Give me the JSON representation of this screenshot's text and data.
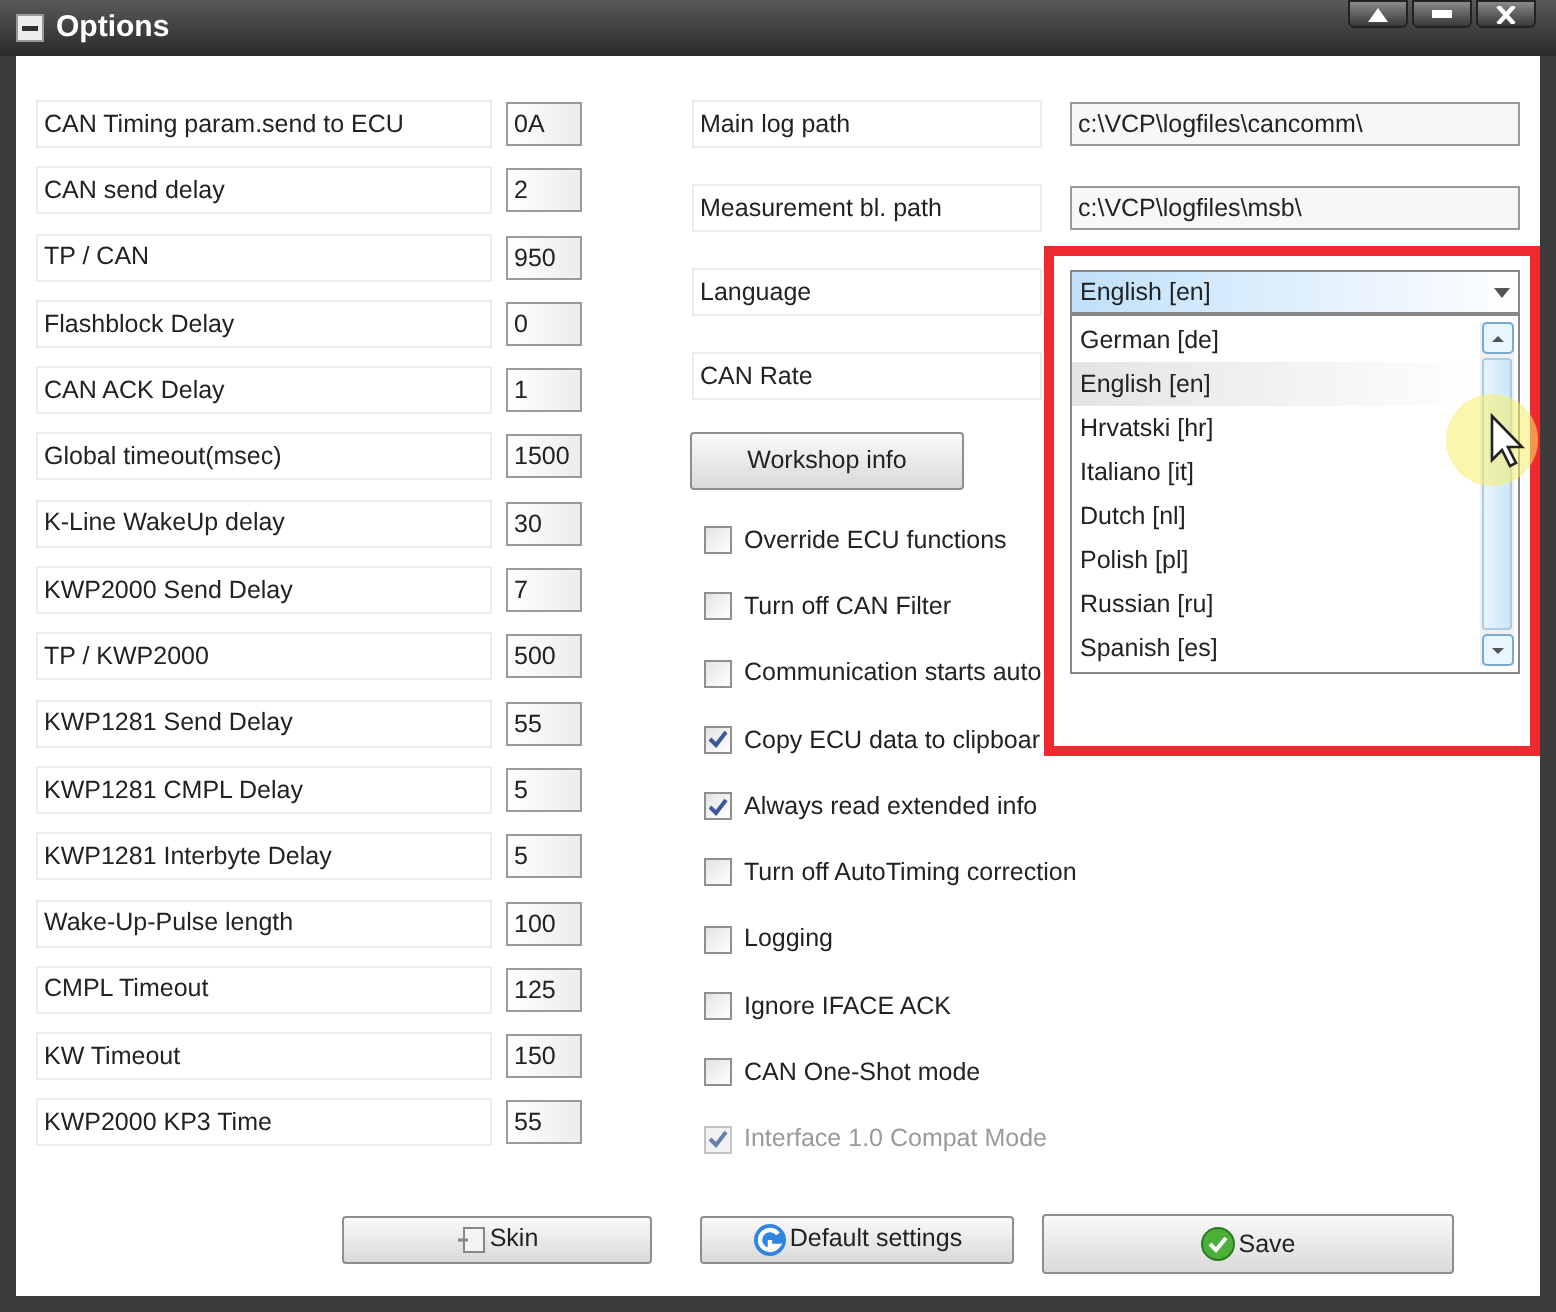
{
  "window": {
    "title": "Options"
  },
  "left_fields": [
    {
      "label": "CAN Timing param.send to ECU",
      "value": "0A"
    },
    {
      "label": "CAN send delay",
      "value": "2"
    },
    {
      "label": "TP / CAN",
      "value": "950"
    },
    {
      "label": "Flashblock Delay",
      "value": "0"
    },
    {
      "label": "CAN ACK Delay",
      "value": "1"
    },
    {
      "label": "Global timeout(msec)",
      "value": "1500"
    },
    {
      "label": "K-Line WakeUp delay",
      "value": "30"
    },
    {
      "label": "KWP2000 Send Delay",
      "value": "7"
    },
    {
      "label": "TP / KWP2000",
      "value": "500"
    },
    {
      "label": "KWP1281 Send Delay",
      "value": "55"
    },
    {
      "label": "KWP1281 CMPL Delay",
      "value": "5"
    },
    {
      "label": "KWP1281 Interbyte Delay",
      "value": "5"
    },
    {
      "label": "Wake-Up-Pulse length",
      "value": "100"
    },
    {
      "label": "CMPL Timeout",
      "value": "125"
    },
    {
      "label": "KW Timeout",
      "value": "150"
    },
    {
      "label": "KWP2000 KP3 Time",
      "value": "55"
    }
  ],
  "paths": [
    {
      "label": "Main log path",
      "value": "c:\\VCP\\logfiles\\cancomm\\"
    },
    {
      "label": "Measurement bl. path",
      "value": "c:\\VCP\\logfiles\\msb\\"
    }
  ],
  "language": {
    "label": "Language",
    "value": "English [en]",
    "options": [
      {
        "label": "German [de]",
        "selected": false
      },
      {
        "label": "English [en]",
        "selected": true
      },
      {
        "label": "Hrvatski [hr]",
        "selected": false
      },
      {
        "label": "Italiano [it]",
        "selected": false
      },
      {
        "label": "Dutch [nl]",
        "selected": false
      },
      {
        "label": "Polish [pl]",
        "selected": false
      },
      {
        "label": "Russian [ru]",
        "selected": false
      },
      {
        "label": "Spanish [es]",
        "selected": false
      }
    ]
  },
  "can_rate": {
    "label": "CAN Rate"
  },
  "workshop_button": "Workshop info",
  "checkboxes": [
    {
      "label": "Override ECU functions",
      "checked": false,
      "disabled": false
    },
    {
      "label": "Turn off CAN Filter",
      "checked": false,
      "disabled": false
    },
    {
      "label": "Communication starts auto",
      "checked": false,
      "disabled": false
    },
    {
      "label": "Copy ECU data to clipboar",
      "checked": true,
      "disabled": false
    },
    {
      "label": "Always read extended info",
      "checked": true,
      "disabled": false
    },
    {
      "label": "Turn off AutoTiming correction",
      "checked": false,
      "disabled": false
    },
    {
      "label": "Logging",
      "checked": false,
      "disabled": false
    },
    {
      "label": "Ignore IFACE ACK",
      "checked": false,
      "disabled": false
    },
    {
      "label": "CAN One-Shot mode",
      "checked": false,
      "disabled": false
    },
    {
      "label": "Interface 1.0 Compat Mode",
      "checked": true,
      "disabled": true
    }
  ],
  "buttons": [
    {
      "label": "Skin",
      "kind": "skin"
    },
    {
      "label": "Default settings",
      "kind": "default"
    },
    {
      "label": "Save",
      "kind": "save"
    }
  ]
}
